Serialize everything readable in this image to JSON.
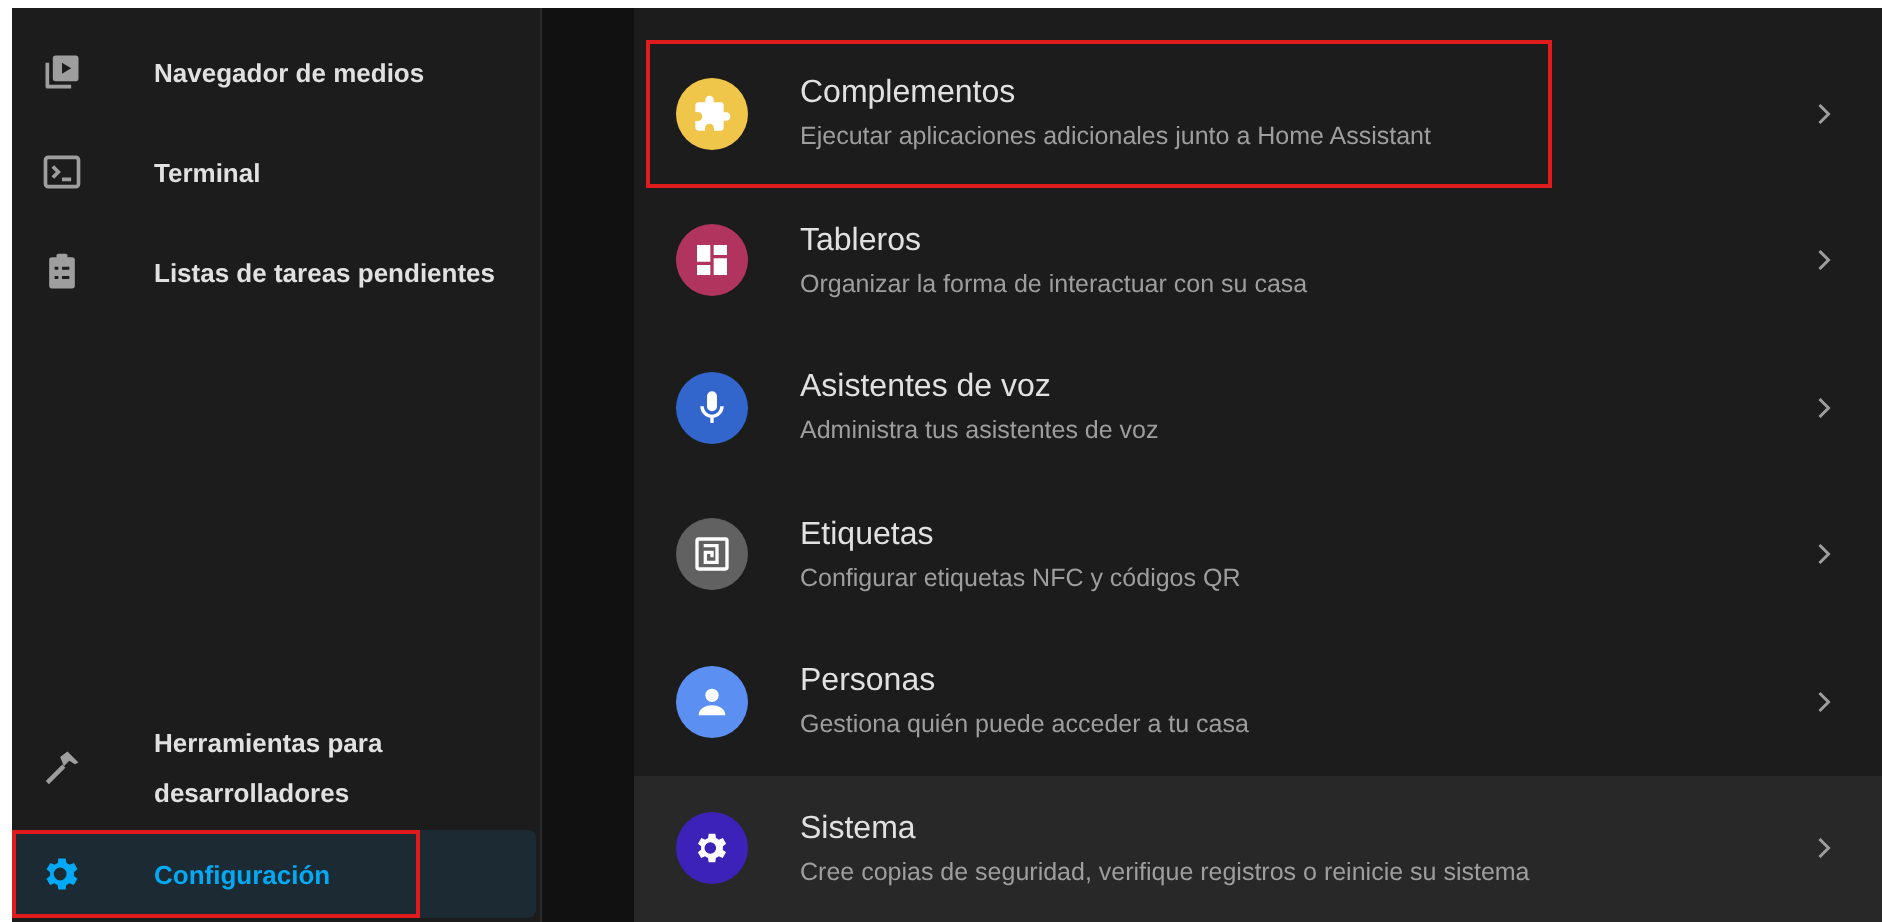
{
  "sidebar": {
    "items": [
      {
        "label": "Navegador de medios",
        "selected": false,
        "highlighted": false
      },
      {
        "label": "Terminal",
        "selected": false,
        "highlighted": false
      },
      {
        "label": "Listas de tareas pendientes",
        "selected": false,
        "highlighted": false
      }
    ],
    "bottom_items": [
      {
        "label": "Herramientas para desarrolladores",
        "selected": false,
        "highlighted": false
      },
      {
        "label": "Configuración",
        "selected": true,
        "highlighted": true
      }
    ]
  },
  "settings": [
    {
      "color": "#f0c64a",
      "title": "Complementos",
      "subtitle": "Ejecutar aplicaciones adicionales junto a Home Assistant",
      "highlighted": true,
      "hovered": false
    },
    {
      "color": "#b0345e",
      "title": "Tableros",
      "subtitle": "Organizar la forma de interactuar con su casa",
      "highlighted": false,
      "hovered": false
    },
    {
      "color": "#3366cc",
      "title": "Asistentes de voz",
      "subtitle": "Administra tus asistentes de voz",
      "highlighted": false,
      "hovered": false
    },
    {
      "color": "#616161",
      "title": "Etiquetas",
      "subtitle": "Configurar etiquetas NFC y códigos QR",
      "highlighted": false,
      "hovered": false
    },
    {
      "color": "#5b8ff2",
      "title": "Personas",
      "subtitle": "Gestiona quién puede acceder a tu casa",
      "highlighted": false,
      "hovered": false
    },
    {
      "color": "#3c22b8",
      "title": "Sistema",
      "subtitle": "Cree copias de seguridad, verifique registros o reinicie su sistema",
      "highlighted": false,
      "hovered": true
    }
  ]
}
